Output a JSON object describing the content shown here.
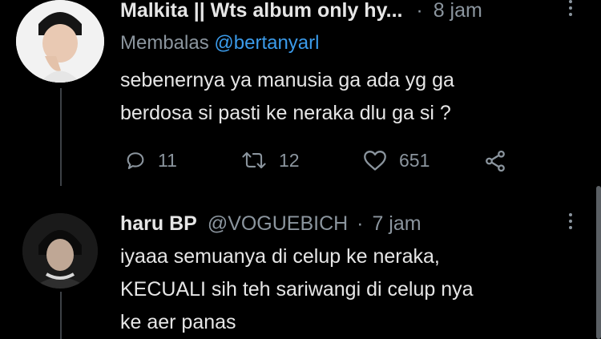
{
  "tweets": [
    {
      "display_name": "Malkita || Wts album only hy...",
      "separator": "·",
      "time": "8 jam",
      "reply_prefix": "Membalas",
      "reply_handle": "@bertanyarl",
      "lines": [
        "sebenernya ya manusia ga ada yg ga",
        "berdosa si pasti ke neraka dlu ga si ?"
      ],
      "actions": {
        "replies": "11",
        "retweets": "12",
        "likes": "651"
      }
    },
    {
      "display_name": "haru BP",
      "handle": "@VOGUEBICH",
      "separator": "·",
      "time": "7 jam",
      "lines": [
        "iyaaa semuanya di celup ke neraka,",
        "KECUALI sih teh sariwangi di celup nya",
        "ke aer panas"
      ]
    }
  ],
  "colors": {
    "background": "#000000",
    "muted": "#8b959e",
    "link": "#3b9bea",
    "text": "#e6e6e6"
  },
  "icons": [
    "reply-icon",
    "retweet-icon",
    "like-icon",
    "share-icon",
    "more-icon"
  ]
}
